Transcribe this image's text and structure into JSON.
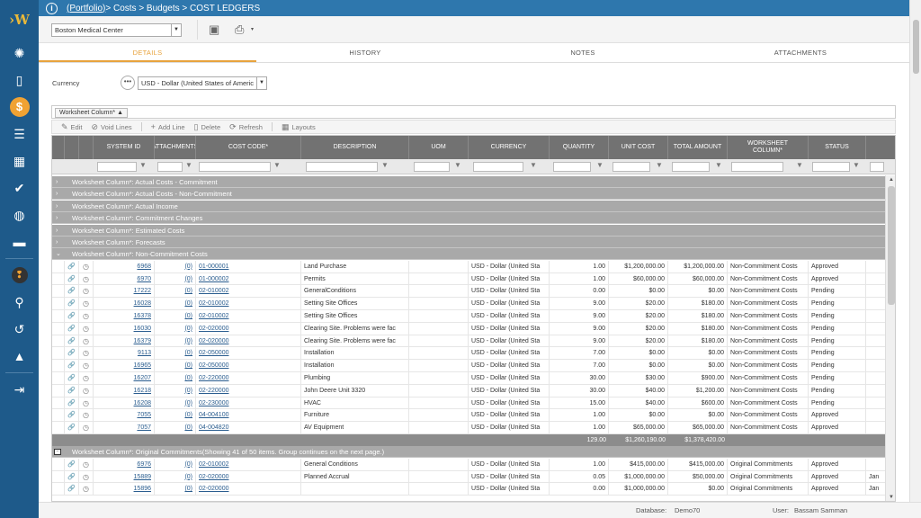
{
  "breadcrumb": {
    "portfolio": "(Portfolio)",
    "rest": " > Costs > Budgets > COST LEDGERS"
  },
  "toolbar": {
    "project": "Boston Medical Center"
  },
  "tabs": [
    {
      "label": "DETAILS"
    },
    {
      "label": "HISTORY"
    },
    {
      "label": "NOTES"
    },
    {
      "label": "ATTACHMENTS"
    }
  ],
  "currency": {
    "label": "Currency",
    "value": "USD - Dollar (United States of Americ"
  },
  "worksheet_chip": "Worksheet Column*",
  "actions": {
    "edit": "Edit",
    "void": "Void Lines",
    "add": "Add Line",
    "delete": "Delete",
    "refresh": "Refresh",
    "layouts": "Layouts"
  },
  "columns": [
    "SYSTEM ID",
    "ATTACHMENTS",
    "COST CODE*",
    "DESCRIPTION",
    "UOM",
    "CURRENCY",
    "QUANTITY",
    "UNIT COST",
    "TOTAL AMOUNT",
    "WORKSHEET COLUMN*",
    "STATUS"
  ],
  "groups_collapsed": [
    "Worksheet Column*: Actual Costs - Commitment",
    "Worksheet Column*: Actual Costs - Non-Commitment",
    "Worksheet Column*: Actual Income",
    "Worksheet Column*: Commitment Changes",
    "Worksheet Column*: Estimated Costs",
    "Worksheet Column*: Forecasts"
  ],
  "group_expanded": "Worksheet Column*: Non-Commitment Costs",
  "rows": [
    {
      "id": "6968",
      "att": "(0)",
      "code": "01-000001",
      "desc": "Land Purchase",
      "cur": "USD - Dollar (United Sta",
      "qty": "1.00",
      "unit": "$1,200,000.00",
      "total": "$1,200,000.00",
      "ws": "Non-Commitment Costs",
      "status": "Approved"
    },
    {
      "id": "6970",
      "att": "(0)",
      "code": "01-000002",
      "desc": "Permits",
      "cur": "USD - Dollar (United Sta",
      "qty": "1.00",
      "unit": "$60,000.00",
      "total": "$60,000.00",
      "ws": "Non-Commitment Costs",
      "status": "Approved"
    },
    {
      "id": "17222",
      "att": "(0)",
      "code": "02-010002",
      "desc": "GeneralConditions",
      "cur": "USD - Dollar (United Sta",
      "qty": "0.00",
      "unit": "$0.00",
      "total": "$0.00",
      "ws": "Non-Commitment Costs",
      "status": "Pending"
    },
    {
      "id": "16028",
      "att": "(0)",
      "code": "02-010002",
      "desc": "Setting Site Offices",
      "cur": "USD - Dollar (United Sta",
      "qty": "9.00",
      "unit": "$20.00",
      "total": "$180.00",
      "ws": "Non-Commitment Costs",
      "status": "Pending"
    },
    {
      "id": "16378",
      "att": "(0)",
      "code": "02-010002",
      "desc": "Setting Site Offices",
      "cur": "USD - Dollar (United Sta",
      "qty": "9.00",
      "unit": "$20.00",
      "total": "$180.00",
      "ws": "Non-Commitment Costs",
      "status": "Pending"
    },
    {
      "id": "16030",
      "att": "(0)",
      "code": "02-020000",
      "desc": "Clearing Site. Problems were fac",
      "cur": "USD - Dollar (United Sta",
      "qty": "9.00",
      "unit": "$20.00",
      "total": "$180.00",
      "ws": "Non-Commitment Costs",
      "status": "Pending"
    },
    {
      "id": "16379",
      "att": "(0)",
      "code": "02-020000",
      "desc": "Clearing Site. Problems were fac",
      "cur": "USD - Dollar (United Sta",
      "qty": "9.00",
      "unit": "$20.00",
      "total": "$180.00",
      "ws": "Non-Commitment Costs",
      "status": "Pending"
    },
    {
      "id": "9113",
      "att": "(0)",
      "code": "02-050000",
      "desc": "Installation",
      "cur": "USD - Dollar (United Sta",
      "qty": "7.00",
      "unit": "$0.00",
      "total": "$0.00",
      "ws": "Non-Commitment Costs",
      "status": "Pending"
    },
    {
      "id": "16965",
      "att": "(0)",
      "code": "02-050000",
      "desc": "Installation",
      "cur": "USD - Dollar (United Sta",
      "qty": "7.00",
      "unit": "$0.00",
      "total": "$0.00",
      "ws": "Non-Commitment Costs",
      "status": "Pending"
    },
    {
      "id": "16207",
      "att": "(0)",
      "code": "02-220000",
      "desc": "Plumbing",
      "cur": "USD - Dollar (United Sta",
      "qty": "30.00",
      "unit": "$30.00",
      "total": "$900.00",
      "ws": "Non-Commitment Costs",
      "status": "Pending"
    },
    {
      "id": "16218",
      "att": "(0)",
      "code": "02-220000",
      "desc": "John Deere Unit 3320",
      "cur": "USD - Dollar (United Sta",
      "qty": "30.00",
      "unit": "$40.00",
      "total": "$1,200.00",
      "ws": "Non-Commitment Costs",
      "status": "Pending"
    },
    {
      "id": "16208",
      "att": "(0)",
      "code": "02-230000",
      "desc": "HVAC",
      "cur": "USD - Dollar (United Sta",
      "qty": "15.00",
      "unit": "$40.00",
      "total": "$600.00",
      "ws": "Non-Commitment Costs",
      "status": "Pending"
    },
    {
      "id": "7055",
      "att": "(0)",
      "code": "04-004100",
      "desc": "Furniture",
      "cur": "USD - Dollar (United Sta",
      "qty": "1.00",
      "unit": "$0.00",
      "total": "$0.00",
      "ws": "Non-Commitment Costs",
      "status": "Approved"
    },
    {
      "id": "7057",
      "att": "(0)",
      "code": "04-004820",
      "desc": "AV Equipment",
      "cur": "USD - Dollar (United Sta",
      "qty": "1.00",
      "unit": "$65,000.00",
      "total": "$65,000.00",
      "ws": "Non-Commitment Costs",
      "status": "Approved"
    }
  ],
  "totals": {
    "qty": "129.00",
    "unit": "$1,260,190.00",
    "total": "$1,378,420.00"
  },
  "group2": "Worksheet Column*: Original Commitments(Showing 41 of 50 items. Group continues on the next page.)",
  "rows2": [
    {
      "id": "6976",
      "att": "(0)",
      "code": "02-010002",
      "desc": "General Conditions",
      "cur": "USD - Dollar (United Sta",
      "qty": "1.00",
      "unit": "$415,000.00",
      "total": "$415,000.00",
      "ws": "Original Commitments",
      "status": "Approved",
      "extra": ""
    },
    {
      "id": "15889",
      "att": "(0)",
      "code": "02-020000",
      "desc": "Planned Accrual",
      "cur": "USD - Dollar (United Sta",
      "qty": "0.05",
      "unit": "$1,000,000.00",
      "total": "$50,000.00",
      "ws": "Original Commitments",
      "status": "Approved",
      "extra": "Jan"
    },
    {
      "id": "15896",
      "att": "(0)",
      "code": "02-020000",
      "desc": "",
      "cur": "USD - Dollar (United Sta",
      "qty": "0.00",
      "unit": "$1,000,000.00",
      "total": "$0.00",
      "ws": "Original Commitments",
      "status": "Approved",
      "extra": "Jan"
    }
  ],
  "status_bar": {
    "db_label": "Database:",
    "db": "Demo70",
    "user_label": "User:",
    "user": "Bassam Samman"
  }
}
